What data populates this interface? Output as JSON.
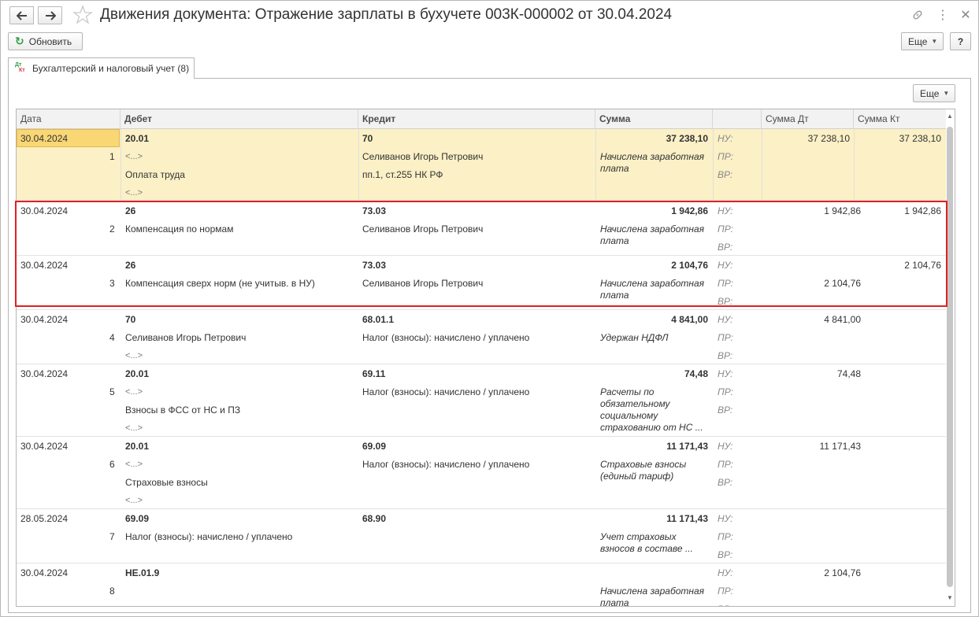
{
  "window": {
    "title": "Движения документа: Отражение зарплаты в бухучете 003К-000002 от 30.04.2024"
  },
  "toolbar": {
    "refresh_label": "Обновить",
    "more_label": "Еще",
    "help_label": "?"
  },
  "tab": {
    "label": "Бухгалтерский и налоговый учет (8)",
    "icon_top": "Дт",
    "icon_bottom": "Кт"
  },
  "panel": {
    "more_label": "Еще"
  },
  "table": {
    "headers": {
      "date": "Дата",
      "debit": "Дебет",
      "credit": "Кредит",
      "sum": "Сумма",
      "sum_dt": "Сумма Дт",
      "sum_kt": "Сумма Кт"
    },
    "tax_labels": {
      "nu": "НУ:",
      "pr": "ПР:",
      "vr": "ВР:"
    },
    "rows": [
      {
        "date": "30.04.2024",
        "num": "1",
        "debit_account": "20.01",
        "debit_sub1": "<...>",
        "debit_sub2": "Оплата труда",
        "debit_sub3": "<...>",
        "credit_account": "70",
        "credit_sub1": "Селиванов Игорь Петрович",
        "credit_sub2": "пп.1, ст.255 НК РФ",
        "sum": "37 238,10",
        "content": "Начислена заработная плата",
        "sum_dt_nu": "37 238,10",
        "sum_kt_nu": "37 238,10",
        "sum_dt_pr": "",
        "sum_kt_pr": ""
      },
      {
        "date": "30.04.2024",
        "num": "2",
        "debit_account": "26",
        "debit_sub1": "Компенсация по нормам",
        "credit_account": "73.03",
        "credit_sub1": "Селиванов Игорь Петрович",
        "sum": "1 942,86",
        "content": "Начислена заработная плата",
        "sum_dt_nu": "1 942,86",
        "sum_kt_nu": "1 942,86",
        "sum_dt_pr": "",
        "sum_kt_pr": ""
      },
      {
        "date": "30.04.2024",
        "num": "3",
        "debit_account": "26",
        "debit_sub1": "Компенсация сверх норм (не учитыв. в НУ)",
        "credit_account": "73.03",
        "credit_sub1": "Селиванов Игорь Петрович",
        "sum": "2 104,76",
        "content": "Начислена заработная плата",
        "sum_dt_nu": "",
        "sum_kt_nu": "2 104,76",
        "sum_dt_pr": "2 104,76",
        "sum_kt_pr": ""
      },
      {
        "date": "30.04.2024",
        "num": "4",
        "debit_account": "70",
        "debit_sub1": "Селиванов Игорь Петрович",
        "debit_sub2": "<...>",
        "credit_account": "68.01.1",
        "credit_sub1": "Налог (взносы): начислено / уплачено",
        "sum": "4 841,00",
        "content": "Удержан НДФЛ",
        "sum_dt_nu": "4 841,00",
        "sum_kt_nu": ""
      },
      {
        "date": "30.04.2024",
        "num": "5",
        "debit_account": "20.01",
        "debit_sub1": "<...>",
        "debit_sub2": "Взносы в ФСС от НС и ПЗ",
        "debit_sub3": "<...>",
        "credit_account": "69.11",
        "credit_sub1": "Налог (взносы): начислено / уплачено",
        "sum": "74,48",
        "content": "Расчеты по обязательному социальному страхованию от НС ...",
        "sum_dt_nu": "74,48",
        "sum_kt_nu": ""
      },
      {
        "date": "30.04.2024",
        "num": "6",
        "debit_account": "20.01",
        "debit_sub1": "<...>",
        "debit_sub2": "Страховые взносы",
        "debit_sub3": "<...>",
        "credit_account": "69.09",
        "credit_sub1": "Налог (взносы): начислено / уплачено",
        "sum": "11 171,43",
        "content": "Страховые взносы (единый тариф)",
        "sum_dt_nu": "11 171,43",
        "sum_kt_nu": ""
      },
      {
        "date": "28.05.2024",
        "num": "7",
        "debit_account": "69.09",
        "debit_sub1": "Налог (взносы): начислено / уплачено",
        "credit_account": "68.90",
        "sum": "11 171,43",
        "content": "Учет страховых взносов в составе ...",
        "sum_dt_nu": "",
        "sum_kt_nu": ""
      },
      {
        "date": "30.04.2024",
        "num": "8",
        "debit_account": "НЕ.01.9",
        "credit_account": "",
        "sum": "",
        "content": "Начислена заработная плата",
        "sum_dt_nu": "2 104,76",
        "sum_kt_nu": ""
      }
    ]
  }
}
